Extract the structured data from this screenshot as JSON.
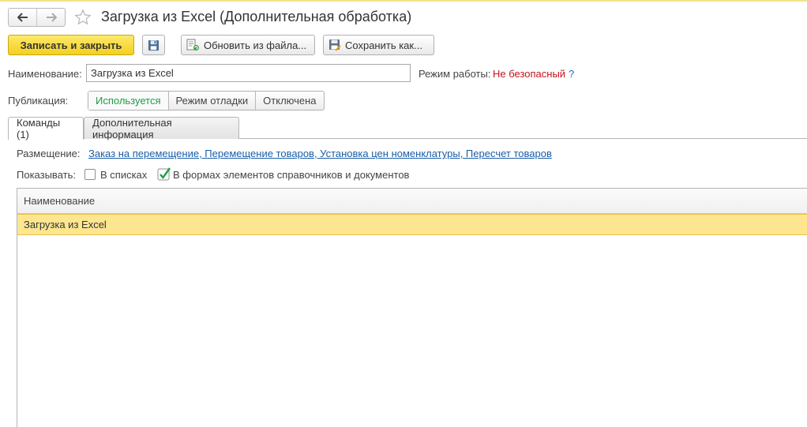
{
  "window": {
    "title": "Загрузка из Excel (Дополнительная обработка)"
  },
  "toolbar": {
    "save_close_label": "Записать и закрыть",
    "refresh_label": "Обновить из файла...",
    "save_as_label": "Сохранить как..."
  },
  "form": {
    "name_label": "Наименование:",
    "name_value": "Загрузка из Excel",
    "mode_label": "Режим работы:",
    "mode_value": "Не безопасный",
    "help_label": "?",
    "publication_label": "Публикация:",
    "publication_options": [
      "Используется",
      "Режим отладки",
      "Отключена"
    ],
    "publication_selected": "Используется"
  },
  "tabs": [
    {
      "label": "Команды (1)"
    },
    {
      "label": "Дополнительная информация"
    }
  ],
  "commands": {
    "placement_label": "Размещение:",
    "placement_value": "Заказ на перемещение, Перемещение товаров, Установка цен номенклатуры, Пересчет товаров",
    "show_label": "Показывать:",
    "show_in_lists_label": "В списках",
    "show_in_lists_checked": false,
    "show_in_forms_label": "В формах элементов справочников и документов",
    "show_in_forms_checked": true,
    "table": {
      "columns": [
        "Наименование"
      ],
      "rows": [
        [
          "Загрузка из Excel"
        ]
      ]
    }
  },
  "colors": {
    "accent": "#f4cf21",
    "selected_row": "#fde68f",
    "active_option": "#1f9a4a",
    "warning_text": "#c0151c",
    "link": "#1a5ea8"
  }
}
